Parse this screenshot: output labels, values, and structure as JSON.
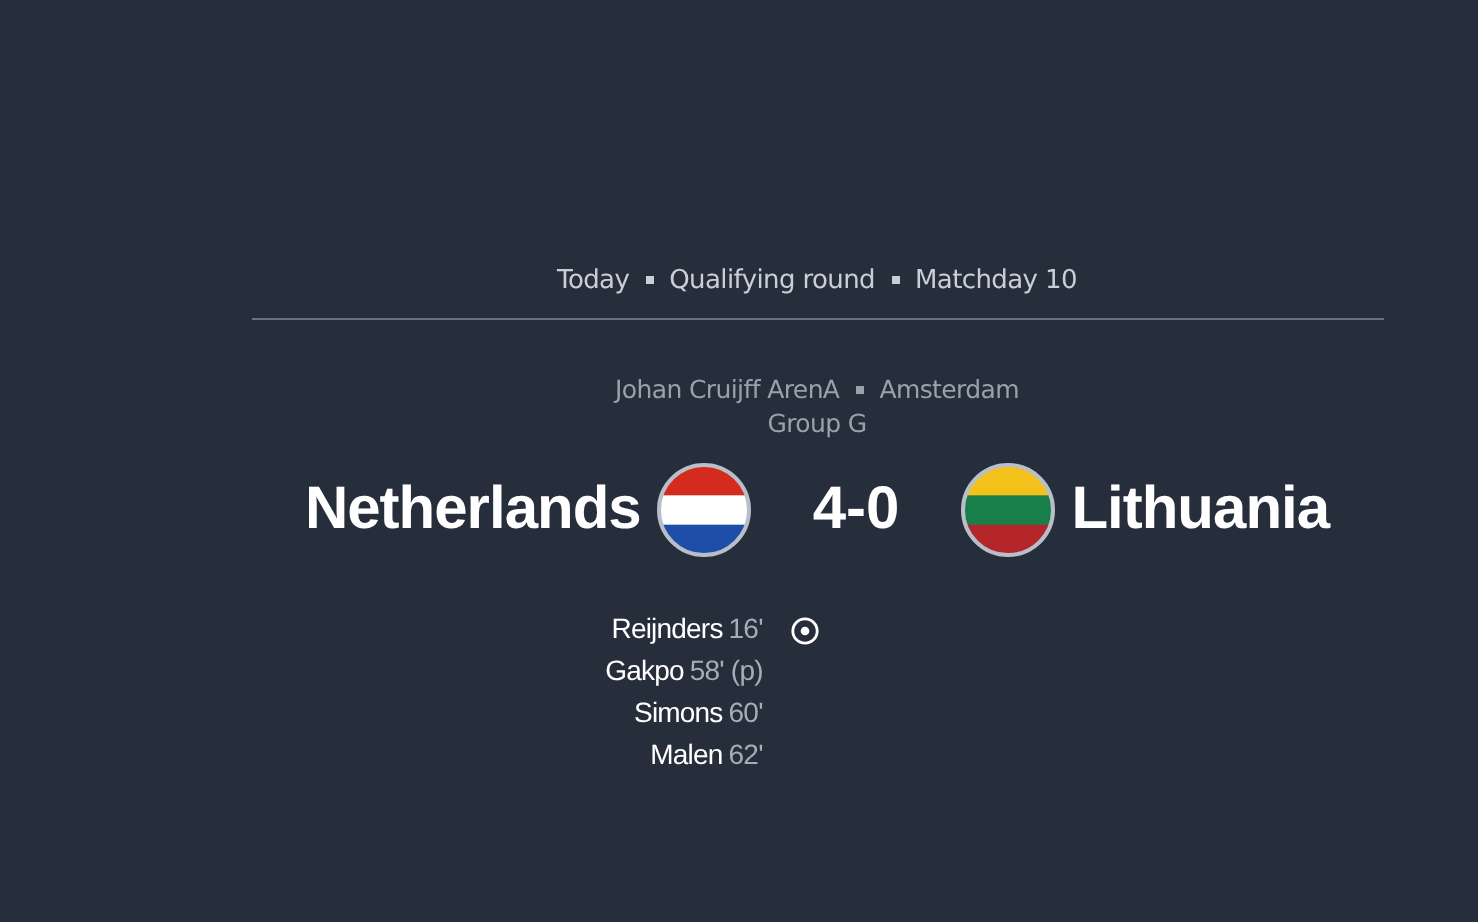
{
  "header": {
    "items": [
      "Today",
      "Qualifying round",
      "Matchday 10"
    ]
  },
  "venue": {
    "stadium": "Johan Cruijff ArenA",
    "city": "Amsterdam",
    "group": "Group G"
  },
  "match": {
    "home": {
      "name": "Netherlands"
    },
    "score": "4-0",
    "away": {
      "name": "Lithuania"
    }
  },
  "goals": [
    {
      "scorer": "Reijnders",
      "minute": "16'"
    },
    {
      "scorer": "Gakpo",
      "minute": "58' (p)"
    },
    {
      "scorer": "Simons",
      "minute": "60'"
    },
    {
      "scorer": "Malen",
      "minute": "62'"
    }
  ]
}
